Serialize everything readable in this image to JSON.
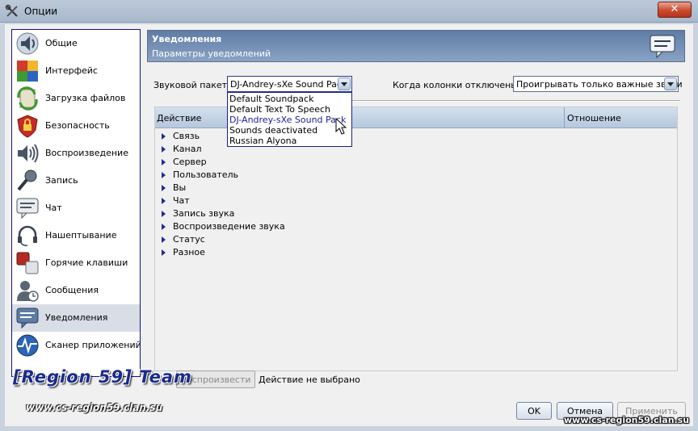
{
  "window": {
    "title": "Опции",
    "close_label": "✕"
  },
  "sidebar": {
    "items": [
      {
        "label": "Общие",
        "icon": "speaker-info-icon"
      },
      {
        "label": "Интерфейс",
        "icon": "palette-grid-icon"
      },
      {
        "label": "Загрузка файлов",
        "icon": "file-transfer-icon"
      },
      {
        "label": "Безопасность",
        "icon": "padlock-icon"
      },
      {
        "label": "Воспроизведение",
        "icon": "speaker-waves-icon"
      },
      {
        "label": "Запись",
        "icon": "microphone-icon"
      },
      {
        "label": "Чат",
        "icon": "chat-bubble-icon"
      },
      {
        "label": "Нашептывание",
        "icon": "headset-icon"
      },
      {
        "label": "Горячие клавиши",
        "icon": "hotkeys-icon"
      },
      {
        "label": "Сообщения",
        "icon": "user-messages-icon"
      },
      {
        "label": "Уведомления",
        "icon": "notification-bubble-icon"
      },
      {
        "label": "Сканер приложений",
        "icon": "app-scanner-icon"
      }
    ],
    "active_index": 10
  },
  "header": {
    "title": "Уведомления",
    "subtitle": "Параметры уведомлений"
  },
  "controls": {
    "soundpack_label": "Звуковой пакет:",
    "soundpack_value": "DJ-Andrey-sXe Sound Pack",
    "speakers_label": "Когда колонки отключены:",
    "speakers_value": "Проигрывать только важные звуки"
  },
  "dropdown": {
    "options": [
      "Default Soundpack",
      "Default Text To Speech",
      "DJ-Andrey-sXe Sound Pack",
      "Sounds deactivated",
      "Russian Alyona"
    ],
    "highlighted_index": 2
  },
  "table": {
    "columns": [
      "Действие",
      "Отношение"
    ],
    "rows": [
      "Связь",
      "Канал",
      "Сервер",
      "Пользователь",
      "Вы",
      "Чат",
      "Запись звука",
      "Воспроизведение звука",
      "Статус",
      "Разное"
    ]
  },
  "bottom": {
    "play_label": "Воспроизвести",
    "status_text": "Действие не выбрано",
    "ok_label": "OK",
    "cancel_label": "Отмена",
    "apply_label": "Применить"
  },
  "watermark": {
    "team": "[Region 59] Team",
    "site_left": "www.cs-region59.clan.su",
    "site_right": "www.cs-region59.clan.su"
  },
  "colors": {
    "accent": "#12127f",
    "banner": "#6d87ad",
    "selection": "#d9dde6"
  }
}
